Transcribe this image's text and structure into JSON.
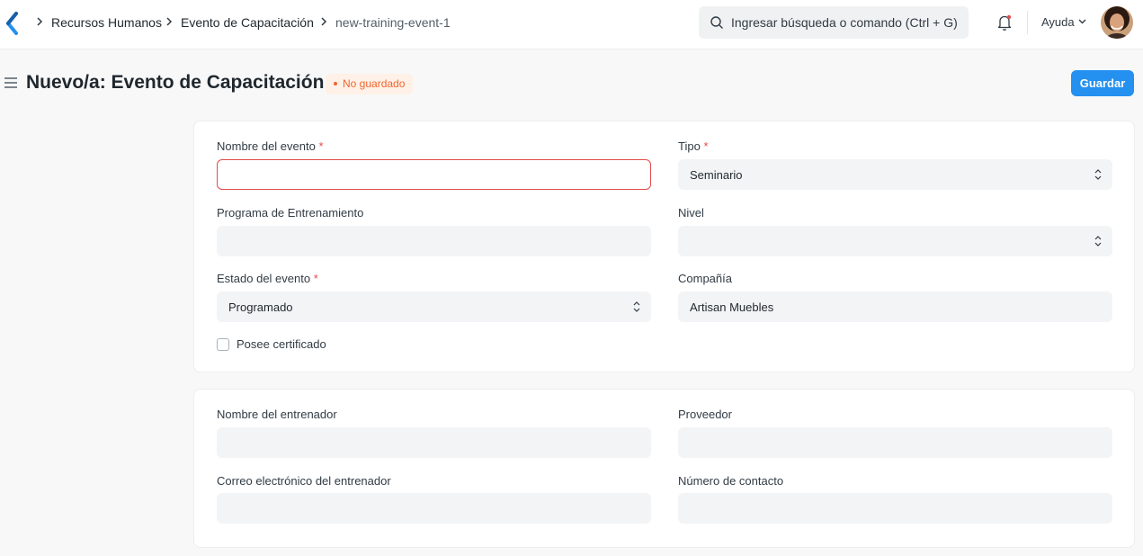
{
  "navbar": {
    "breadcrumbs": [
      "Recursos Humanos",
      "Evento de Capacitación",
      "new-training-event-1"
    ],
    "search_placeholder": "Ingresar búsqueda o comando (Ctrl + G)",
    "help_label": "Ayuda"
  },
  "page": {
    "title": "Nuevo/a: Evento de Capacitación",
    "status_badge": "No guardado",
    "save_label": "Guardar"
  },
  "section1": {
    "event_name_label": "Nombre del evento",
    "event_name_value": "",
    "type_label": "Tipo",
    "type_value": "Seminario",
    "program_label": "Programa de Entrenamiento",
    "program_value": "",
    "level_label": "Nivel",
    "level_value": "",
    "status_label": "Estado del evento",
    "status_value": "Programado",
    "company_label": "Compañía",
    "company_value": "Artisan Muebles",
    "certificate_label": "Posee certificado",
    "certificate_checked": false,
    "required_mark": "*"
  },
  "section2": {
    "trainer_name_label": "Nombre del entrenador",
    "supplier_label": "Proveedor",
    "trainer_email_label": "Correo electrónico del entrenador",
    "contact_number_label": "Número de contacto"
  },
  "colors": {
    "primary": "#2490ef",
    "error": "#e24c4c",
    "badge_text": "#f0652f",
    "badge_bg": "#fff1e7",
    "logo": "#2490ef"
  },
  "icons": [
    "app-logo-icon",
    "chevron-right-icon",
    "search-icon",
    "bell-icon",
    "chevron-down-icon",
    "hamburger-icon",
    "select-chevron-icon"
  ]
}
